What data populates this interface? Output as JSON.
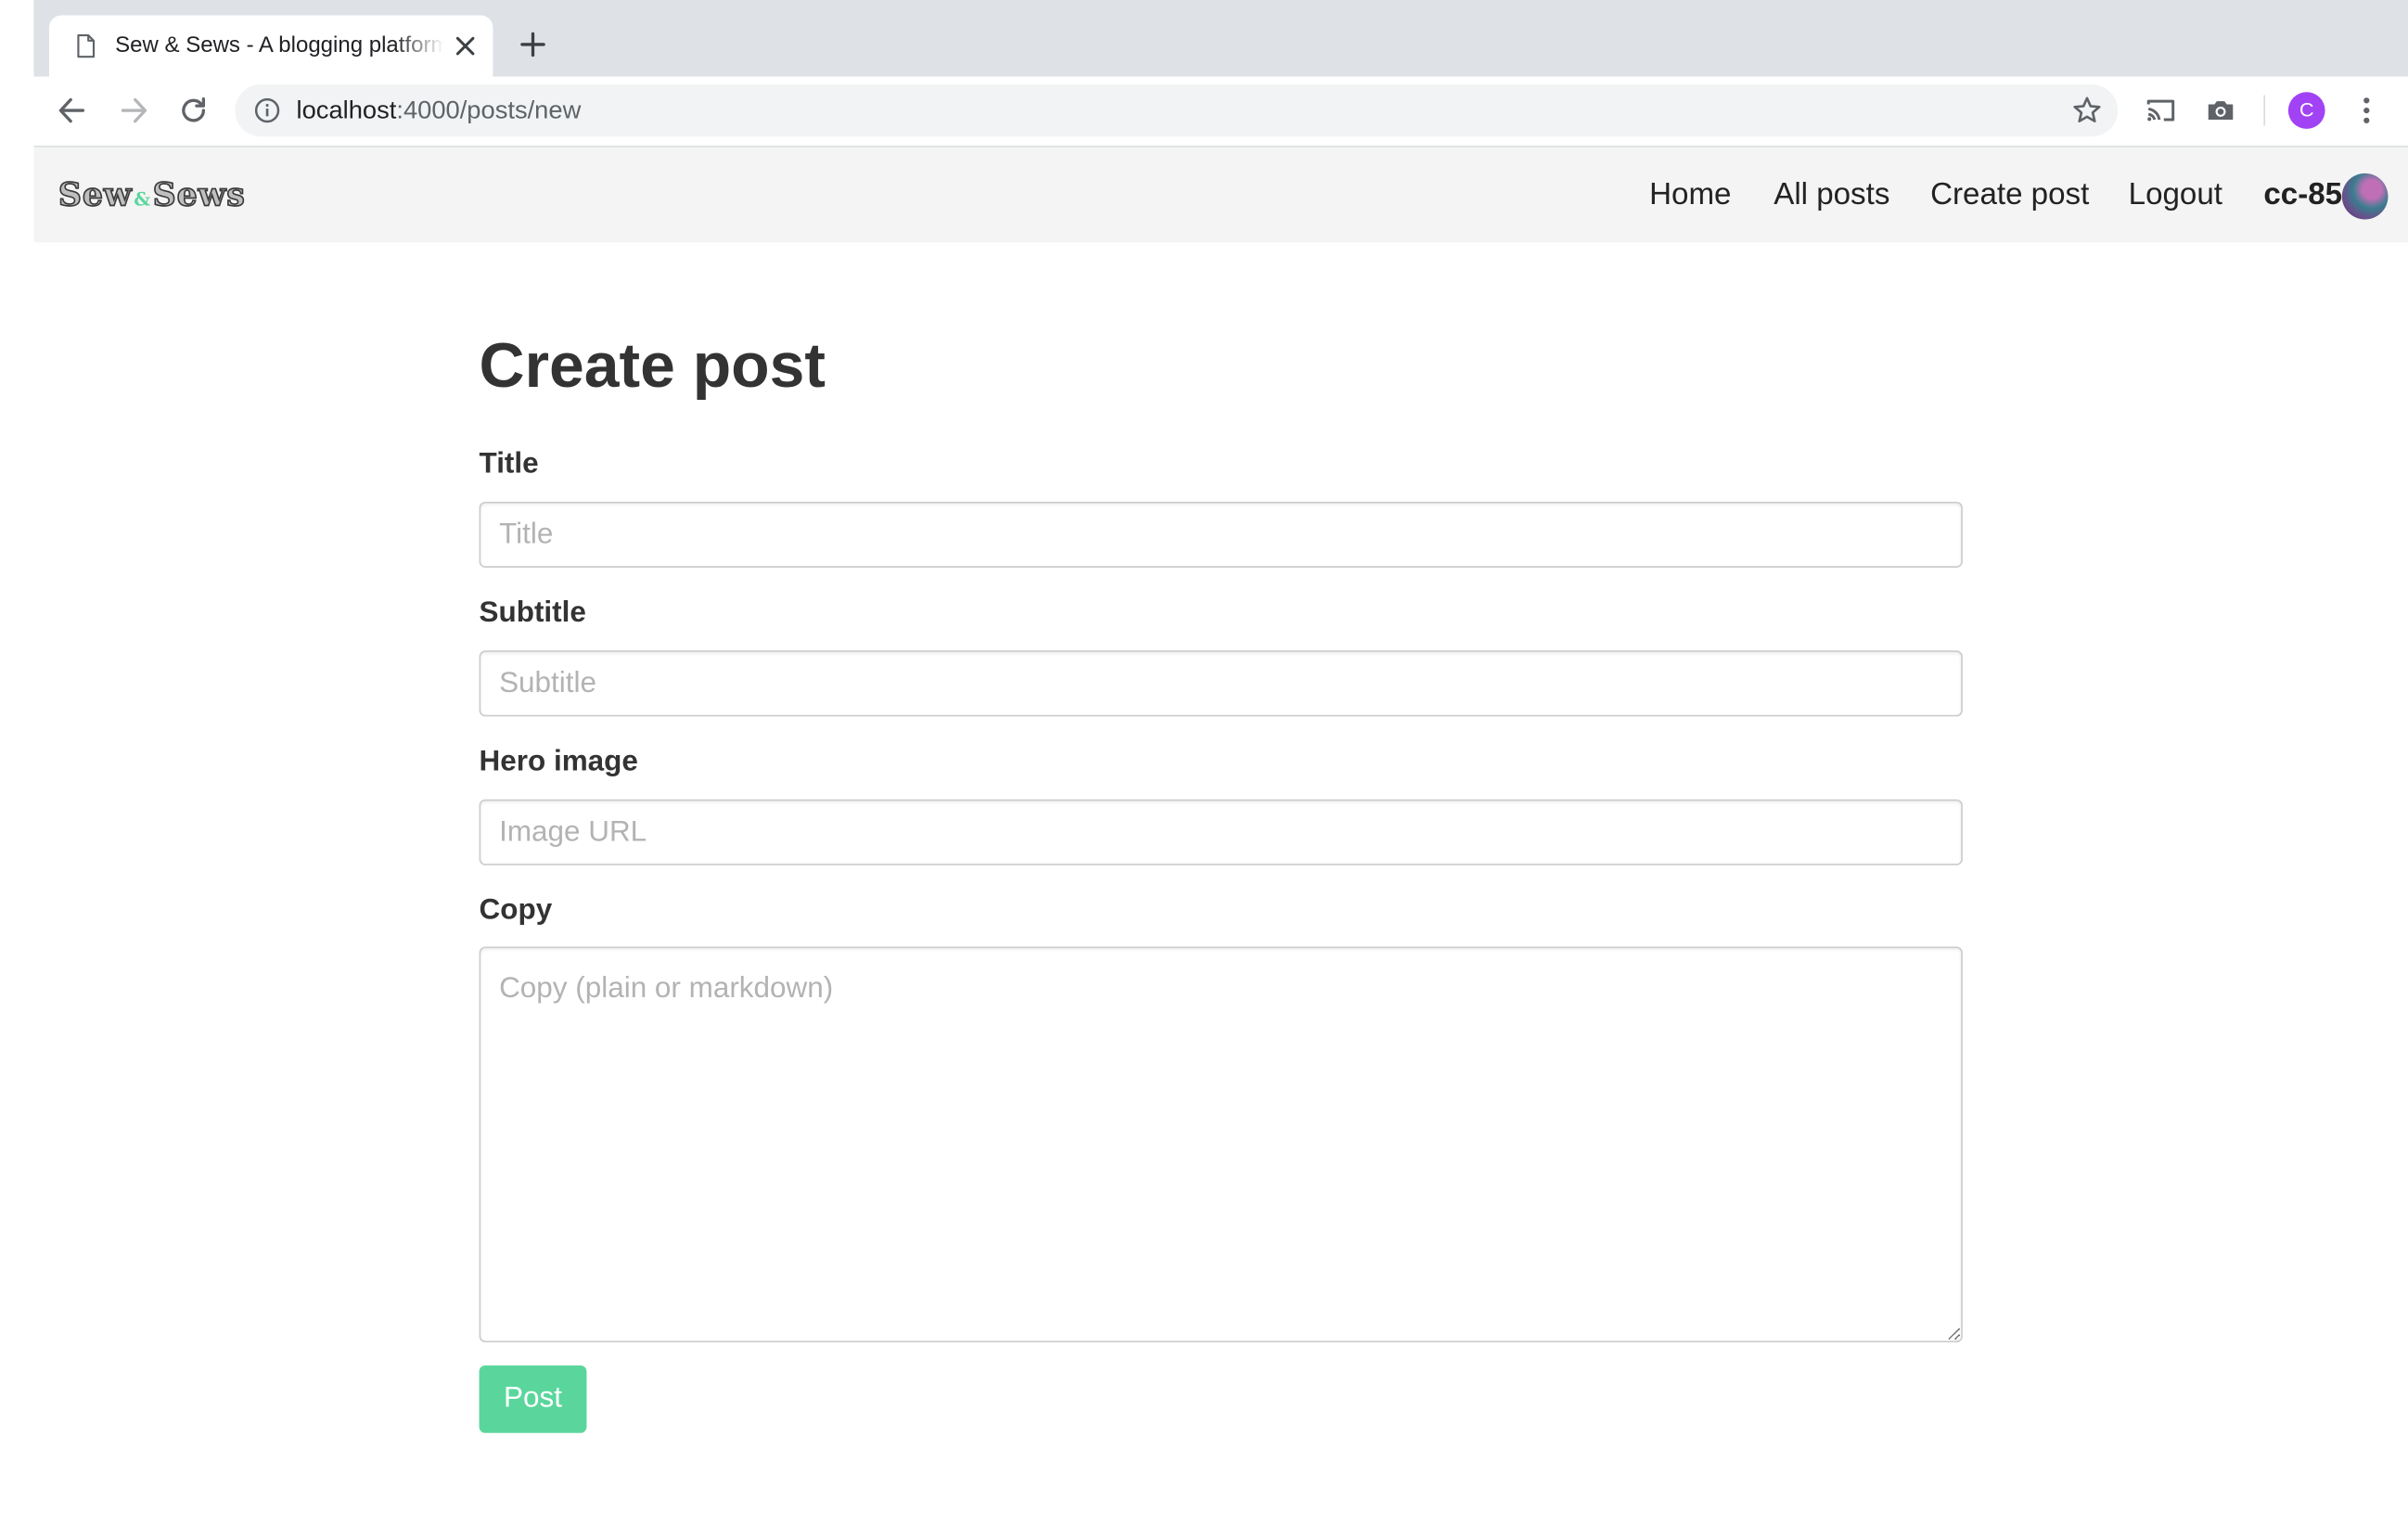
{
  "browser": {
    "tab_title": "Sew & Sews - A blogging platform",
    "url_host": "localhost",
    "url_path": ":4000/posts/new",
    "profile_initial": "C"
  },
  "site": {
    "brand_left": "Sew",
    "brand_amp": "&",
    "brand_right": "Sews",
    "nav": {
      "home": "Home",
      "all_posts": "All posts",
      "create_post": "Create post",
      "logout": "Logout",
      "username": "cc-85"
    }
  },
  "form": {
    "heading": "Create post",
    "title_label": "Title",
    "title_placeholder": "Title",
    "subtitle_label": "Subtitle",
    "subtitle_placeholder": "Subtitle",
    "hero_label": "Hero image",
    "hero_placeholder": "Image URL",
    "copy_label": "Copy",
    "copy_placeholder": "Copy (plain or markdown)",
    "submit_label": "Post"
  },
  "colors": {
    "accent": "#5ad69c",
    "profile": "#a142f4",
    "navbar_bg": "#f4f4f4",
    "tabstrip_bg": "#dee1e6"
  }
}
